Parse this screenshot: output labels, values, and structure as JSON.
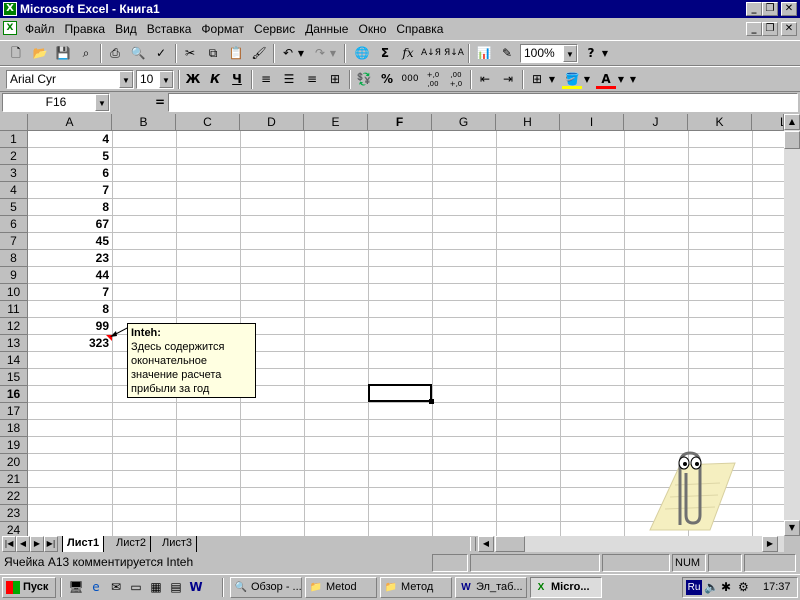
{
  "window": {
    "title": "Microsoft Excel - Книга1"
  },
  "menu": [
    "Файл",
    "Правка",
    "Вид",
    "Вставка",
    "Формат",
    "Сервис",
    "Данные",
    "Окно",
    "Справка"
  ],
  "toolbar": {
    "zoom": "100%",
    "font_name": "Arial Cyr",
    "font_size": "10",
    "bold_label": "Ж",
    "italic_label": "К",
    "underline_label": "Ч",
    "percent_label": "%",
    "thousands_label": "000",
    "sum_label": "Σ",
    "fx_label": "fx",
    "inc_decimal_label": "+,0 ,00",
    "dec_decimal_label": ",00 +,0",
    "help_label": "?"
  },
  "formula_bar": {
    "name_box": "F16",
    "equals": "=",
    "content": ""
  },
  "columns": [
    "A",
    "B",
    "C",
    "D",
    "E",
    "F",
    "G",
    "H",
    "I",
    "J",
    "K",
    "L"
  ],
  "rows": [
    "1",
    "2",
    "3",
    "4",
    "5",
    "6",
    "7",
    "8",
    "9",
    "10",
    "11",
    "12",
    "13",
    "14",
    "15",
    "16",
    "17",
    "18",
    "19",
    "20",
    "21",
    "22",
    "23",
    "24"
  ],
  "cells_A": [
    "4",
    "5",
    "6",
    "7",
    "8",
    "67",
    "45",
    "23",
    "44",
    "7",
    "8",
    "99",
    "323",
    "",
    "",
    "",
    "",
    "",
    "",
    "",
    "",
    "",
    "",
    ""
  ],
  "active_cell": "F16",
  "comment": {
    "author": "Inteh:",
    "lines": [
      "Здесь содержится",
      "окончательное",
      "значение расчета",
      "прибыли за год"
    ]
  },
  "sheets": [
    "Лист1",
    "Лист2",
    "Лист3"
  ],
  "status": {
    "message": "Ячейка A13 комментируется Inteh",
    "num": "NUM"
  },
  "taskbar": {
    "start_label": "Пуск",
    "items": [
      "Обзор - ...",
      "Metod",
      "Метод",
      "Эл_таб...",
      "Micro..."
    ],
    "lang": "Ru",
    "clock": "17:37"
  },
  "colors": {
    "title_bg": "#000080",
    "comment_bg": "#ffffe1",
    "face": "#c0c0c0"
  }
}
